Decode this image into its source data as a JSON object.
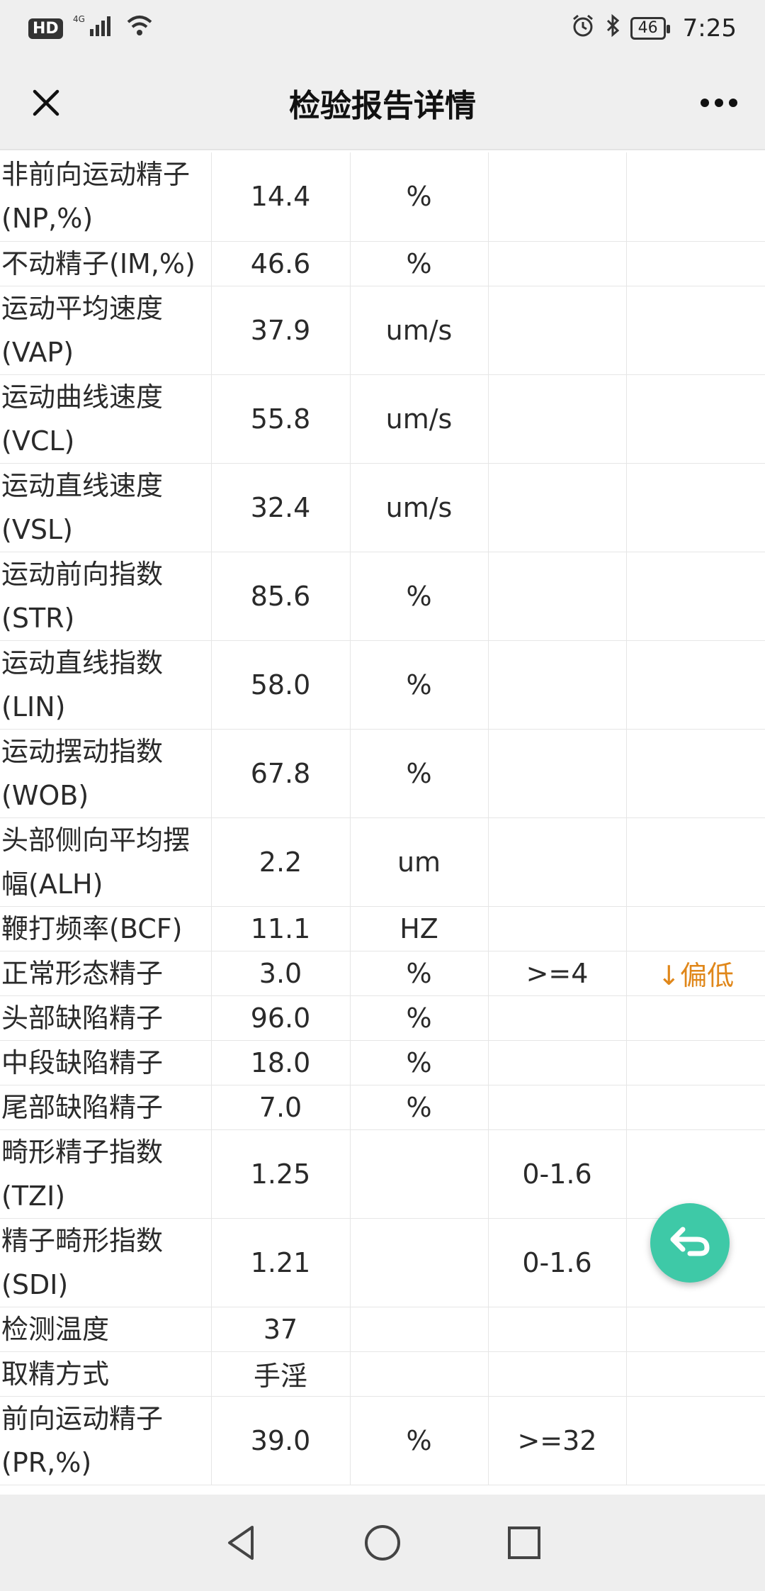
{
  "status_bar": {
    "hd": "HD",
    "network": "4G",
    "battery": "46",
    "time": "7:25"
  },
  "header": {
    "title": "检验报告详情",
    "close_icon": "close-icon",
    "more_icon": "more-icon"
  },
  "table": {
    "rows": [
      {
        "name": "非前向运动精子(NP,%)",
        "value": "14.4",
        "unit": "%",
        "ref": "",
        "flag": "",
        "tall": true
      },
      {
        "name": "不动精子(IM,%)",
        "value": "46.6",
        "unit": "%",
        "ref": "",
        "flag": "",
        "tall": false
      },
      {
        "name": "运动平均速度(VAP)",
        "value": "37.9",
        "unit": "um/s",
        "ref": "",
        "flag": "",
        "tall": true
      },
      {
        "name": "运动曲线速度(VCL)",
        "value": "55.8",
        "unit": "um/s",
        "ref": "",
        "flag": "",
        "tall": true
      },
      {
        "name": "运动直线速度(VSL)",
        "value": "32.4",
        "unit": "um/s",
        "ref": "",
        "flag": "",
        "tall": true
      },
      {
        "name": "运动前向指数(STR)",
        "value": "85.6",
        "unit": "%",
        "ref": "",
        "flag": "",
        "tall": true
      },
      {
        "name": "运动直线指数(LIN)",
        "value": "58.0",
        "unit": "%",
        "ref": "",
        "flag": "",
        "tall": true
      },
      {
        "name": "运动摆动指数(WOB)",
        "value": "67.8",
        "unit": "%",
        "ref": "",
        "flag": "",
        "tall": true
      },
      {
        "name": "头部侧向平均摆幅(ALH)",
        "value": "2.2",
        "unit": "um",
        "ref": "",
        "flag": "",
        "tall": true
      },
      {
        "name": "鞭打频率(BCF)",
        "value": "11.1",
        "unit": "HZ",
        "ref": "",
        "flag": "",
        "tall": false
      },
      {
        "name": "正常形态精子",
        "value": "3.0",
        "unit": "%",
        "ref": ">=4",
        "flag": "↓偏低",
        "tall": false
      },
      {
        "name": "头部缺陷精子",
        "value": "96.0",
        "unit": "%",
        "ref": "",
        "flag": "",
        "tall": false
      },
      {
        "name": "中段缺陷精子",
        "value": "18.0",
        "unit": "%",
        "ref": "",
        "flag": "",
        "tall": false
      },
      {
        "name": "尾部缺陷精子",
        "value": "7.0",
        "unit": "%",
        "ref": "",
        "flag": "",
        "tall": false
      },
      {
        "name": "畸形精子指数(TZI)",
        "value": "1.25",
        "unit": "",
        "ref": "0-1.6",
        "flag": "",
        "tall": true
      },
      {
        "name": "精子畸形指数(SDI)",
        "value": "1.21",
        "unit": "",
        "ref": "0-1.6",
        "flag": "",
        "tall": true
      },
      {
        "name": "检测温度",
        "value": "37",
        "unit": "",
        "ref": "",
        "flag": "",
        "tall": false
      },
      {
        "name": "取精方式",
        "value": "手淫",
        "unit": "",
        "ref": "",
        "flag": "",
        "tall": false
      },
      {
        "name": "前向运动精子(PR,%)",
        "value": "39.0",
        "unit": "%",
        "ref": ">=32",
        "flag": "",
        "tall": true
      }
    ]
  },
  "fab": {
    "icon": "return-icon",
    "color": "#3ec9a7"
  },
  "bottom_nav": {
    "back_icon": "back-triangle-icon",
    "home_icon": "home-circle-icon",
    "recent_icon": "recent-square-icon"
  },
  "colors": {
    "flag_low": "#e0871a",
    "header_bg": "#efefef"
  }
}
